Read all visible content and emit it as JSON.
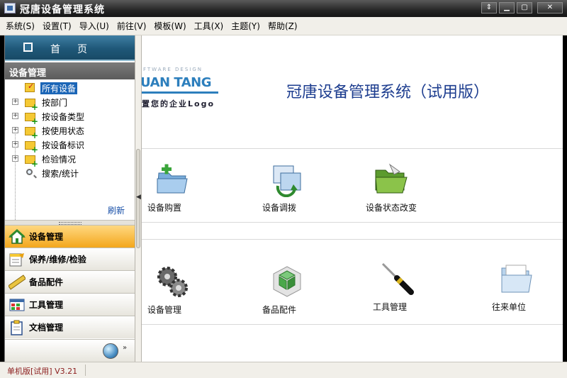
{
  "window": {
    "title": "冠唐设备管理系统"
  },
  "menu": [
    "系统(S)",
    "设置(T)",
    "导入(U)",
    "前往(V)",
    "模板(W)",
    "工具(X)",
    "主题(Y)",
    "帮助(Z)"
  ],
  "sidebar": {
    "home_label": "首页",
    "section_title": "设备管理",
    "tree": [
      {
        "label": "所有设备",
        "expandable": false,
        "selected": true,
        "icon": "checked-folder-icon"
      },
      {
        "label": "按部门",
        "expandable": true,
        "icon": "folder-add-icon"
      },
      {
        "label": "按设备类型",
        "expandable": true,
        "icon": "folder-add-icon"
      },
      {
        "label": "按使用状态",
        "expandable": true,
        "icon": "folder-add-icon"
      },
      {
        "label": "按设备标识",
        "expandable": true,
        "icon": "folder-add-icon"
      },
      {
        "label": "检验情况",
        "expandable": true,
        "icon": "folder-add-icon"
      },
      {
        "label": "搜索/统计",
        "expandable": false,
        "icon": "search-icon"
      }
    ],
    "refresh_label": "刷新",
    "nav": [
      {
        "label": "设备管理",
        "active": true,
        "icon": "house-icon"
      },
      {
        "label": "保养/维修/检验",
        "active": false,
        "icon": "note-icon"
      },
      {
        "label": "备品配件",
        "active": false,
        "icon": "ruler-icon"
      },
      {
        "label": "工具管理",
        "active": false,
        "icon": "grid-icon"
      },
      {
        "label": "文档管理",
        "active": false,
        "icon": "clipboard-icon"
      }
    ]
  },
  "main": {
    "logo": {
      "tagline": "FTWARE DESIGN",
      "brand": "UAN TANG",
      "sub": "置您的企业Logo"
    },
    "heading": "冠唐设备管理系统（试用版）",
    "tiles_row1": [
      {
        "label": "设备购置",
        "icon": "folder-add-icon"
      },
      {
        "label": "设备调拨",
        "icon": "transfer-icon"
      },
      {
        "label": "设备状态改变",
        "icon": "green-folder-icon"
      }
    ],
    "tiles_row2": [
      {
        "label": "设备管理",
        "icon": "gears-icon"
      },
      {
        "label": "备品配件",
        "icon": "cubes-icon"
      },
      {
        "label": "工具管理",
        "icon": "screwdriver-icon"
      },
      {
        "label": "往来单位",
        "icon": "open-folder-icon"
      }
    ]
  },
  "statusbar": {
    "text": "单机版[试用]  V3.21"
  },
  "colors": {
    "accent": "#f3a71c",
    "header_blue": "#1f5878",
    "heading_blue": "#1d3d8f",
    "selection": "#1c66b7"
  }
}
